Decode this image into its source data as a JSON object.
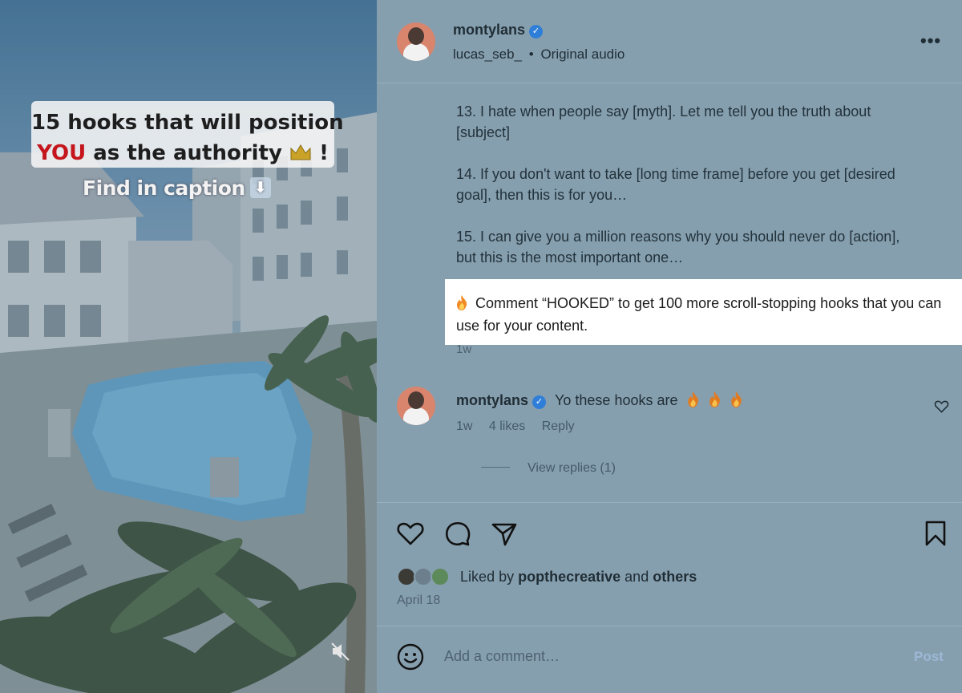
{
  "media": {
    "hook_line1": "15 hooks that will position",
    "hook_you": "YOU",
    "hook_line2_rest": "as the authority",
    "hook_exclaim": "!",
    "caption_hint": "Find in caption",
    "hint_arrow": "⬇",
    "icons": [
      "crown-icon",
      "down-arrow-icon",
      "muted-speaker-icon"
    ]
  },
  "header": {
    "username": "montylans",
    "verified_mark": "✓",
    "audio_user": "lucas_seb_",
    "separator": "•",
    "audio_label": "Original audio",
    "more_label": "•••"
  },
  "caption": {
    "item13": "13. I hate when people say [myth]. Let me tell you the truth about [subject]",
    "item14": "14. If you don't want to take [long time frame] before you get [desired goal], then this is for you…",
    "item15": "15. I can give you a million reasons why you should never do [action], but this is the most important one…",
    "cta": "Comment “HOOKED” to get 100 more scroll-stopping hooks that you can use for your content.",
    "time": "1w"
  },
  "comment": {
    "username": "montylans",
    "text": "Yo these hooks are",
    "emoji_count": 3,
    "time": "1w",
    "likes": "4 likes",
    "reply": "Reply",
    "view_replies": "View replies (1)"
  },
  "actions": {
    "liked_prefix": "Liked by",
    "liked_user": "popthecreative",
    "liked_and": "and",
    "liked_others": "others",
    "date": "April 18"
  },
  "comment_box": {
    "placeholder": "Add a comment…",
    "post_label": "Post"
  },
  "colors": {
    "overlay": "#869fae",
    "verified": "#2f7fd8",
    "highlight_bg": "#ffffff",
    "hook_red": "#c4161c",
    "post_disabled": "#9cb8d6"
  }
}
